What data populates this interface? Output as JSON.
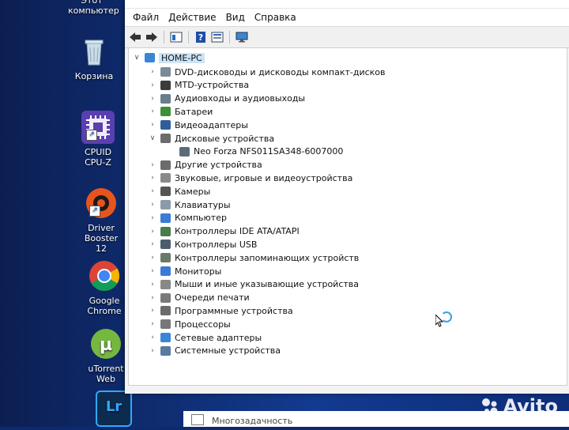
{
  "desktop": {
    "icons": [
      {
        "label": "Этот компьютер"
      },
      {
        "label": "Корзина"
      },
      {
        "label": "CPUID CPU-Z"
      },
      {
        "label": "Driver Booster 12"
      },
      {
        "label": "Google Chrome"
      },
      {
        "label": "uTorrent Web"
      },
      {
        "label": "Lr"
      }
    ]
  },
  "menubar": {
    "items": [
      {
        "label": "Файл"
      },
      {
        "label": "Действие"
      },
      {
        "label": "Вид"
      },
      {
        "label": "Справка"
      }
    ]
  },
  "toolbar": {
    "back_icon": "⬅",
    "forward_icon": "➡",
    "help_icon": "?"
  },
  "tree": {
    "root": "HOME-PC",
    "items": [
      {
        "label": "DVD-дисководы и дисководы компакт-дисков",
        "expanded": false
      },
      {
        "label": "MTD-устройства",
        "expanded": false
      },
      {
        "label": "Аудиовходы и аудиовыходы",
        "expanded": false
      },
      {
        "label": "Батареи",
        "expanded": false
      },
      {
        "label": "Видеоадаптеры",
        "expanded": false
      },
      {
        "label": "Дисковые устройства",
        "expanded": true,
        "chevron": "∨"
      },
      {
        "label": "Neo Forza NFS011SA348-6007000",
        "child": true
      },
      {
        "label": "Другие устройства",
        "expanded": false
      },
      {
        "label": "Звуковые, игровые и видеоустройства",
        "expanded": false
      },
      {
        "label": "Камеры",
        "expanded": false
      },
      {
        "label": "Клавиатуры",
        "expanded": false
      },
      {
        "label": "Компьютер",
        "expanded": false
      },
      {
        "label": "Контроллеры IDE ATA/ATAPI",
        "expanded": false
      },
      {
        "label": "Контроллеры USB",
        "expanded": false
      },
      {
        "label": "Контроллеры запоминающих устройств",
        "expanded": false
      },
      {
        "label": "Мониторы",
        "expanded": false
      },
      {
        "label": "Мыши и иные указывающие устройства",
        "expanded": false
      },
      {
        "label": "Очереди печати",
        "expanded": false
      },
      {
        "label": "Программные устройства",
        "expanded": false
      },
      {
        "label": "Процессоры",
        "expanded": false
      },
      {
        "label": "Сетевые адаптеры",
        "expanded": false
      },
      {
        "label": "Системные устройства",
        "expanded": false
      }
    ],
    "collapsed_chevron": "›",
    "expand_chevron": "∨"
  },
  "taskbar": {
    "label": "Многозадачность"
  },
  "watermark": {
    "text": "Avito"
  },
  "colors": {
    "selection": "#cce4f7",
    "desktop_bg": "#123a8f",
    "accent": "#1a5fc9"
  }
}
